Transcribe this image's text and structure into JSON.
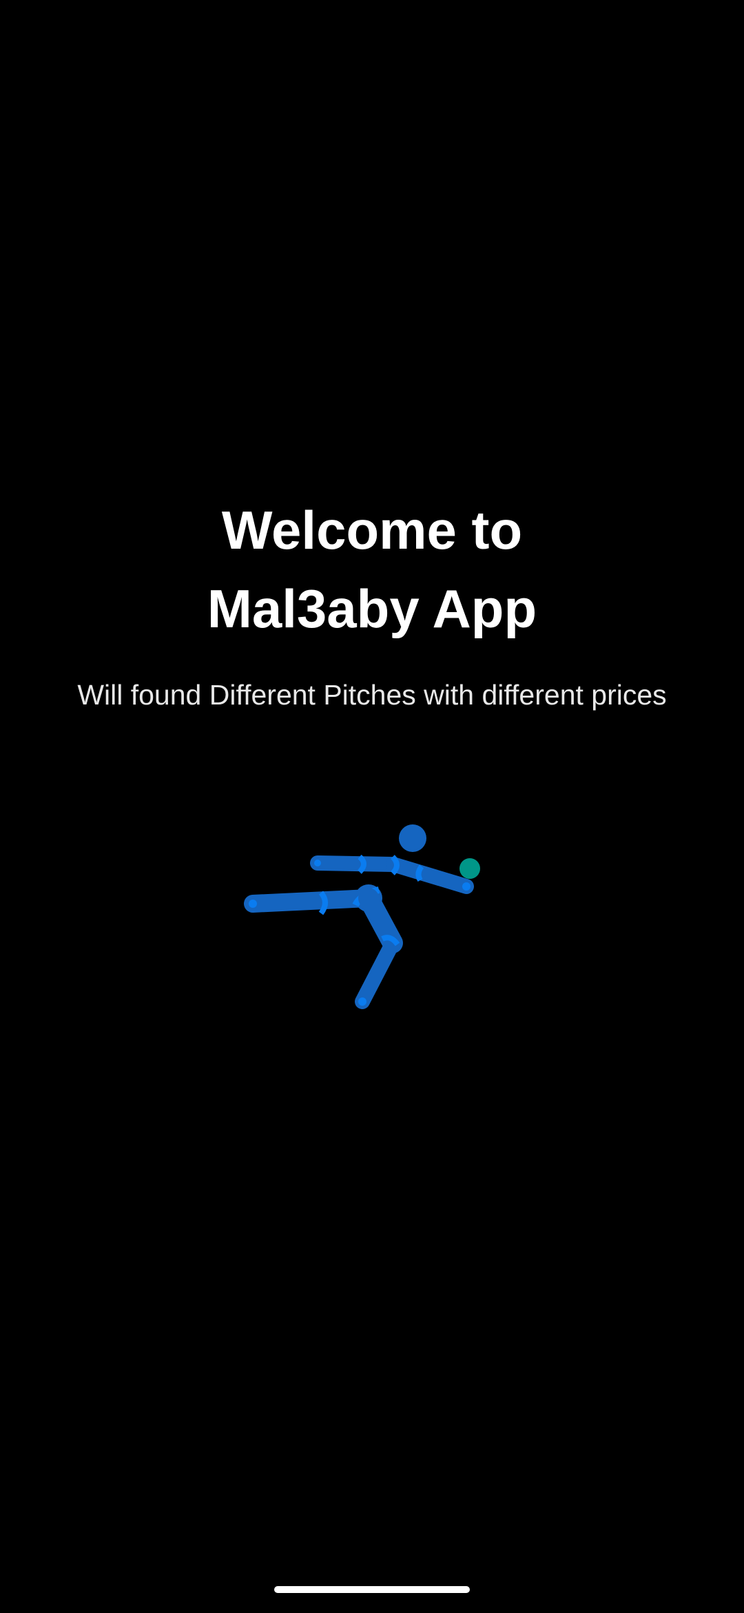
{
  "welcome": {
    "title_line1": "Welcome to",
    "title_line2": "Mal3aby App",
    "subtitle": "Will found Different Pitches with different prices"
  },
  "illustration": {
    "icon": "football-player-kicking-icon",
    "body_color": "#1565C0",
    "joint_color": "#0A7CF0",
    "ball_color": "#009688"
  },
  "system": {
    "home_indicator_color": "#FFFFFF"
  }
}
